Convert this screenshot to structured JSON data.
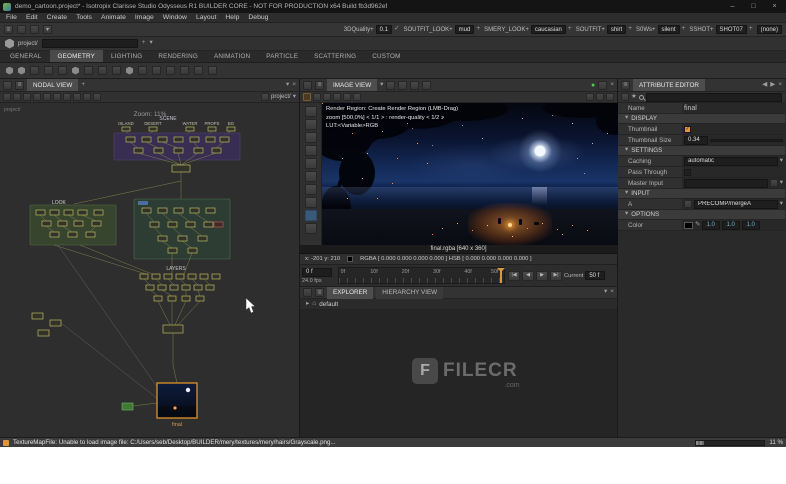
{
  "window": {
    "title": "demo_cartoon.project* - Isotropix Clarisse Studio Odysseus R1 BUILDER CORE - NOT FOR PRODUCTION x64  Build fb3d962ef"
  },
  "icons": {
    "menu": "≡",
    "dropdown": "▾",
    "arrow_small": "▸",
    "close": "×",
    "minimize": "–",
    "maximize": "□",
    "check": "✓",
    "plus": "+",
    "home": "⌂",
    "left": "◀",
    "right": "▶",
    "pen": "✎",
    "star": "★",
    "circle_dot": "●"
  },
  "menubar": {
    "items": [
      "File",
      "Edit",
      "Create",
      "Tools",
      "Animate",
      "Image",
      "Window",
      "Layout",
      "Help",
      "Debug"
    ]
  },
  "context_toolbar": {
    "fields": [
      {
        "label": "3DQuality+",
        "value": "0.1"
      },
      {
        "label": "SOUTFIT_LOOK+",
        "value": "mud"
      },
      {
        "label": "SMERY_LOOK+",
        "value": "caucasian"
      },
      {
        "label": "SOUTFIT+",
        "value": "shirt"
      },
      {
        "label": "S0Ws+",
        "value": "silent"
      },
      {
        "label": "SSHOT+",
        "value": "SHOT07"
      }
    ],
    "none": "(none)"
  },
  "path_bar": {
    "label": "project/"
  },
  "ribbon_tabs": [
    "GENERAL",
    "GEOMETRY",
    "LIGHTING",
    "RENDERING",
    "ANIMATION",
    "PARTICLE",
    "SCATTERING",
    "CUSTOM"
  ],
  "nodal": {
    "tab": "NODAL VIEW",
    "breadcrumb": "project/",
    "canvas_label": "project/",
    "zoom": "Zoom: 11%",
    "scene": "SCENE",
    "look": "LOOK",
    "layers": "LAYERS",
    "top_nodes": [
      "ISLAND",
      "DESERT",
      "WATER",
      "PROPS",
      "BG"
    ],
    "final": "final"
  },
  "image_view": {
    "tab": "IMAGE VIEW",
    "overlay_line1": "Render Region: Create Render Region (LMB-Drag)",
    "overlay_line2": "zoom [500,0%] < 1/1 >  : render-quality < 1/2 >",
    "overlay_line3": "LUT:<Variable>RGB",
    "caption": "final.rgba [640 x 360]",
    "cursor": "x: -201 y: 210",
    "values": "RGBA [ 0.000 0.000 0.000 0.000 ]    HSB [ 0.000 0.000 0.000 0.000 ]"
  },
  "timeline": {
    "start_frame": "0 f",
    "fps": "24.0 fps",
    "ticks": [
      "0f",
      "10f",
      "20f",
      "30f",
      "40f",
      "50f"
    ],
    "buttons": [
      "|◀",
      "◀",
      "▶",
      "▶|"
    ],
    "current_label": "Current",
    "current_value": "50 f"
  },
  "explorer": {
    "tabs": [
      "EXPLORER",
      "HIERARCHY VIEW"
    ],
    "item": "default"
  },
  "attribute_editor": {
    "tab": "ATTRIBUTE EDITOR",
    "name_label": "Name",
    "name_value": "final",
    "display": {
      "header": "DISPLAY",
      "thumbnail_label": "Thumbnail",
      "thumbnail_size_label": "Thumbnail Size",
      "thumbnail_size_value": "0.34"
    },
    "settings": {
      "header": "SETTINGS",
      "caching_label": "Caching",
      "caching_value": "automatic",
      "pass_through_label": "Pass Through",
      "master_input_label": "Master Input"
    },
    "input": {
      "header": "INPUT",
      "a_label": "A",
      "a_value": "PRECOMP/mergeA"
    },
    "options": {
      "header": "OPTIONS",
      "color_label": "Color",
      "color_values": [
        "1.0",
        "1.0",
        "1.0"
      ]
    }
  },
  "status_bar": {
    "message": "TextureMapFile: Unable to load image file: C:/Users/seb/Desktop/BUILDER/mery/textures/mery/hairs/Grayscale.png...",
    "progress": "11 %"
  },
  "watermark": {
    "text": "FILECR",
    "suffix": ".com",
    "logo": "F"
  },
  "colors": {
    "accent_orange": "#e0973c",
    "node_outline": "#c2c25e",
    "value_teal": "#6fb3c9",
    "indicator_green": "#56c556"
  }
}
